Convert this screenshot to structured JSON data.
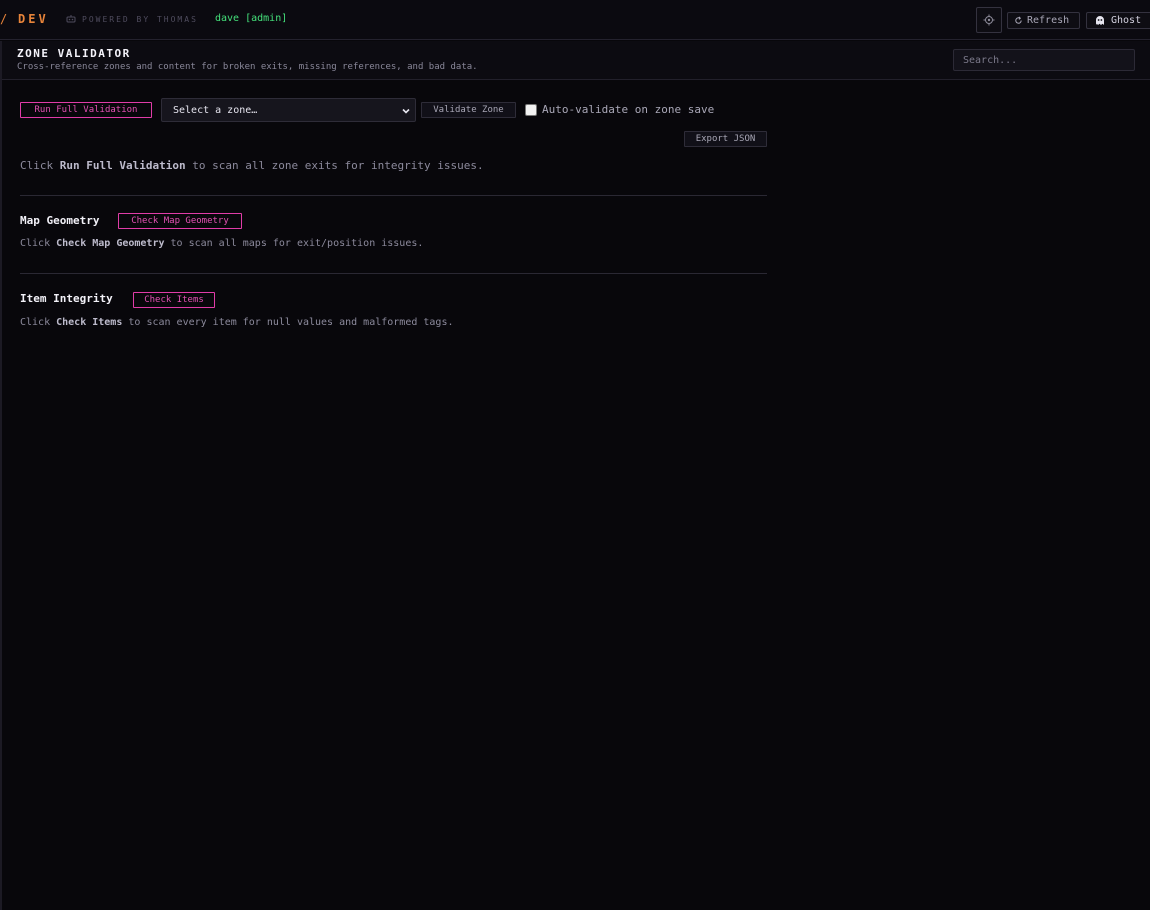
{
  "topbar": {
    "brand_slash": "/",
    "brand_name": "DEV",
    "powered_by": "POWERED BY THOMAS",
    "user": "dave [admin]",
    "refresh_label": "Refresh",
    "ghost_label": "Ghost"
  },
  "header": {
    "title": "ZONE VALIDATOR",
    "subtitle": "Cross-reference zones and content for broken exits, missing references, and bad data.",
    "search_placeholder": "Search..."
  },
  "controls": {
    "run_full_label": "Run Full Validation",
    "zone_select_value": "Select a zone…",
    "validate_zone_label": "Validate Zone",
    "auto_validate_label": "Auto-validate on zone save",
    "auto_validate_checked": false,
    "export_label": "Export JSON"
  },
  "zone_exits": {
    "text_before": "Click ",
    "text_bold": "Run Full Validation",
    "text_after": " to scan all zone exits for integrity issues."
  },
  "map_geometry": {
    "title": "Map Geometry",
    "button_label": "Check Map Geometry",
    "text_before": "Click ",
    "text_bold": "Check Map Geometry",
    "text_after": " to scan all maps for exit/position issues."
  },
  "item_integrity": {
    "title": "Item Integrity",
    "button_label": "Check Items",
    "text_before": "Click ",
    "text_bold": "Check Items",
    "text_after": " to scan every item for null values and malformed tags."
  },
  "colors": {
    "accent_pink": "#e03ca8",
    "brand_orange": "#e8843a",
    "user_green": "#44e07a",
    "background": "#08070b"
  },
  "icons": {
    "powered": "robot-icon",
    "settings": "gear-icon",
    "refresh": "refresh-icon",
    "ghost": "ghost-icon",
    "select": "chevron-down-icon"
  }
}
